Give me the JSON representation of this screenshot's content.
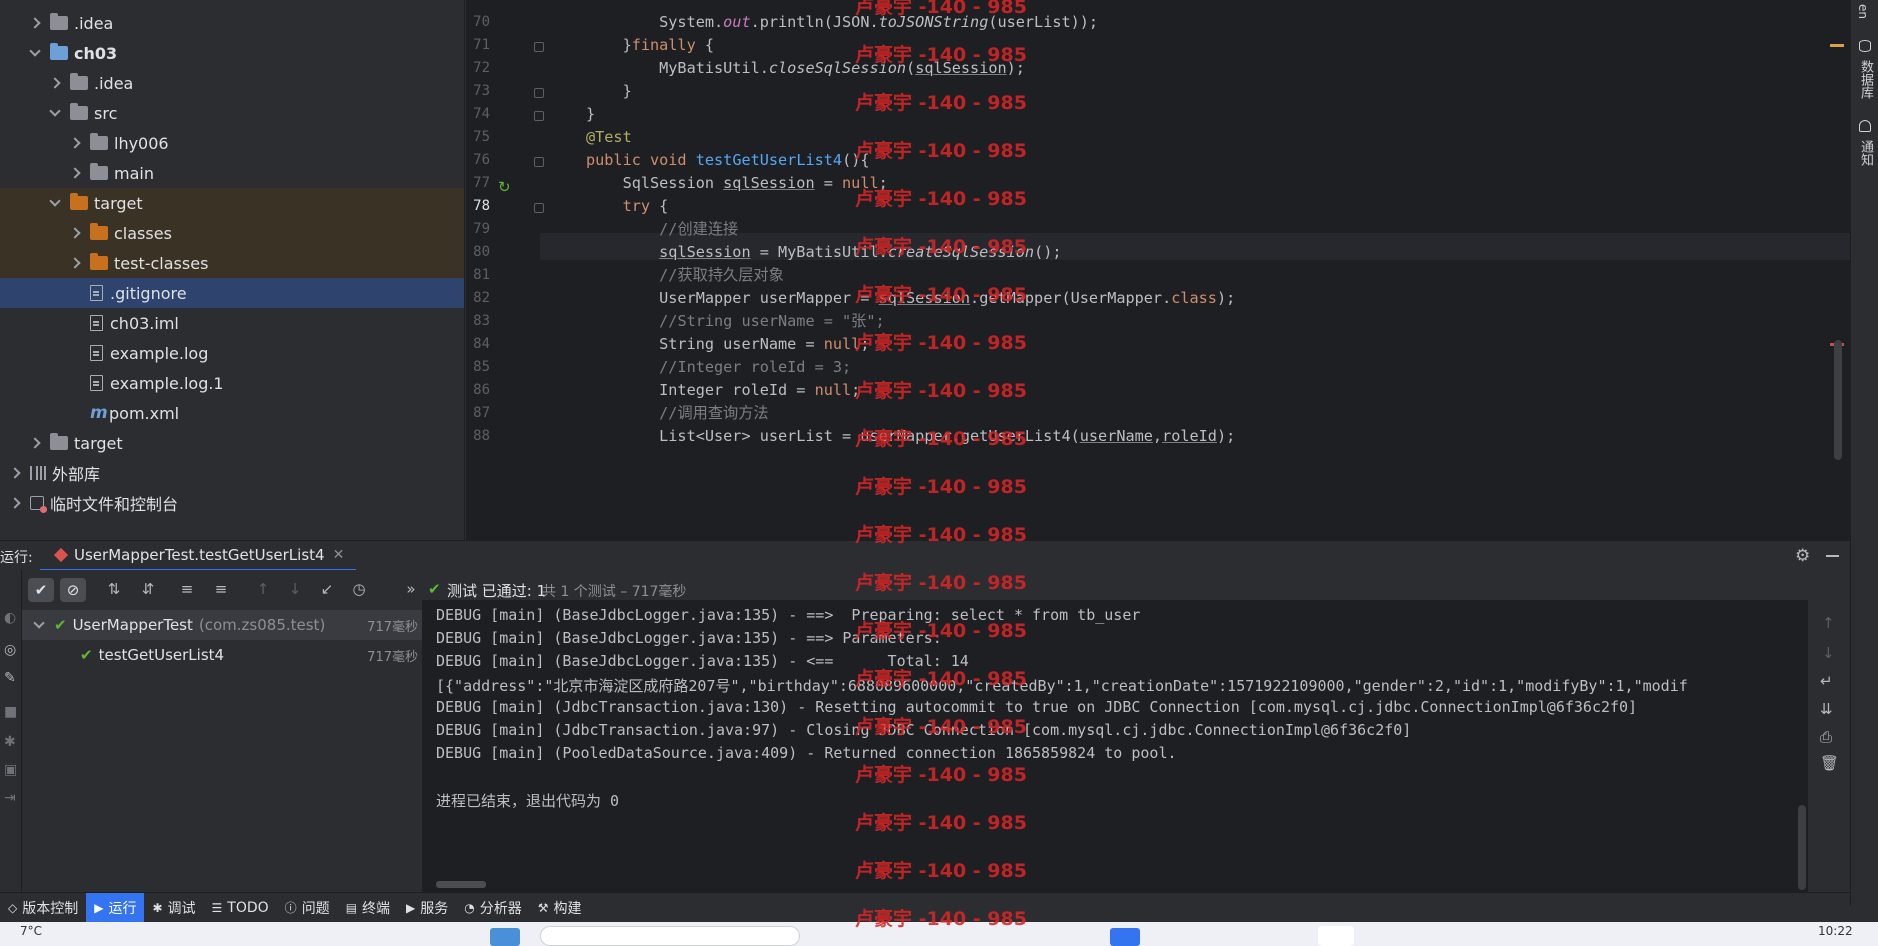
{
  "project_tree": [
    {
      "label": ".idea",
      "indent": 1,
      "state": "collapsed",
      "icon": "folder"
    },
    {
      "label": "ch03",
      "indent": 1,
      "state": "expanded",
      "icon": "module-folder",
      "bold": true
    },
    {
      "label": ".idea",
      "indent": 2,
      "state": "collapsed",
      "icon": "folder"
    },
    {
      "label": "src",
      "indent": 2,
      "state": "expanded",
      "icon": "folder"
    },
    {
      "label": "lhy006",
      "indent": 3,
      "state": "collapsed",
      "icon": "folder"
    },
    {
      "label": "main",
      "indent": 3,
      "state": "collapsed",
      "icon": "folder"
    },
    {
      "label": "target",
      "indent": 2,
      "state": "expanded",
      "icon": "folder-orange",
      "highlight": "target"
    },
    {
      "label": "classes",
      "indent": 3,
      "state": "collapsed",
      "icon": "folder-orange",
      "highlight": "target"
    },
    {
      "label": "test-classes",
      "indent": 3,
      "state": "collapsed",
      "icon": "folder-orange",
      "highlight": "target"
    },
    {
      "label": ".gitignore",
      "indent": 3,
      "state": "leaf",
      "icon": "file",
      "highlight": "select"
    },
    {
      "label": "ch03.iml",
      "indent": 3,
      "state": "leaf",
      "icon": "file"
    },
    {
      "label": "example.log",
      "indent": 3,
      "state": "leaf",
      "icon": "file"
    },
    {
      "label": "example.log.1",
      "indent": 3,
      "state": "leaf",
      "icon": "file"
    },
    {
      "label": "pom.xml",
      "indent": 3,
      "state": "leaf",
      "icon": "maven"
    },
    {
      "label": "target",
      "indent": 1,
      "state": "collapsed",
      "icon": "folder"
    },
    {
      "label": "外部库",
      "indent": 0,
      "state": "collapsed",
      "icon": "library"
    },
    {
      "label": "临时文件和控制台",
      "indent": 0,
      "state": "collapsed",
      "icon": "scratch"
    }
  ],
  "editor": {
    "line_numbers": [
      "70",
      "71",
      "72",
      "73",
      "74",
      "75",
      "76",
      "77",
      "78",
      "79",
      "80",
      "81",
      "82",
      "83",
      "84",
      "85",
      "86",
      "87",
      "88"
    ],
    "current_line": "78"
  },
  "run_panel": {
    "title": "运行:",
    "tab_label": "UserMapperTest.testGetUserList4",
    "status_passed": "测试 已通过: 1",
    "status_detail": "共 1 个测试 – 717毫秒",
    "test_root": "UserMapperTest",
    "test_root_pkg": "(com.zs085.test)",
    "test_root_time": "717毫秒",
    "test_child": "testGetUserList4",
    "test_child_time": "717毫秒"
  },
  "console_lines": [
    "DEBUG [main] (BaseJdbcLogger.java:135) - ==>  Preparing: select * from tb_user",
    "DEBUG [main] (BaseJdbcLogger.java:135) - ==> Parameters: ",
    "DEBUG [main] (BaseJdbcLogger.java:135) - <==      Total: 14",
    "[{\"address\":\"北京市海淀区成府路207号\",\"birthday\":688089600000,\"createdBy\":1,\"creationDate\":1571922109000,\"gender\":2,\"id\":1,\"modifyBy\":1,\"modif",
    "DEBUG [main] (JdbcTransaction.java:130) - Resetting autocommit to true on JDBC Connection [com.mysql.cj.jdbc.ConnectionImpl@6f36c2f0]",
    "DEBUG [main] (JdbcTransaction.java:97) - Closing JDBC Connection [com.mysql.cj.jdbc.ConnectionImpl@6f36c2f0]",
    "DEBUG [main] (PooledDataSource.java:409) - Returned connection 1865859824 to pool.",
    "",
    "进程已结束，退出代码为 0"
  ],
  "bottom_bar": [
    "版本控制",
    "运行",
    "调试",
    "TODO",
    "问题",
    "终端",
    "服务",
    "分析器",
    "构建"
  ],
  "right_strip": [
    "数据库",
    "通知"
  ],
  "watermark": "卢豪宇 -140 - 985",
  "taskbar": {
    "weather": "7°C",
    "clock": "10:22"
  },
  "colors": {
    "accent": "#3574f0",
    "pass": "#5fb832",
    "watermark": "#d72626"
  }
}
